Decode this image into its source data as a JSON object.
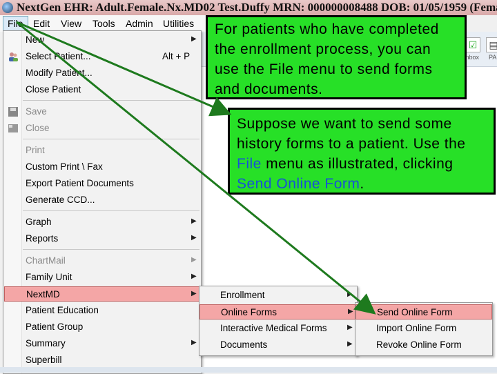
{
  "window": {
    "title": "NextGen EHR: Adult.Female.Nx.MD02 Test.Duffy MRN: 000000008488 DOB: 01/05/1959 (Femal"
  },
  "menubar": {
    "file": "File",
    "edit": "Edit",
    "view": "View",
    "tools": "Tools",
    "admin": "Admin",
    "utilities": "Utilities"
  },
  "toolbar": {
    "inbox": "Inbox",
    "pa": "PA"
  },
  "file_menu": {
    "new": "New",
    "select_patient": "Select Patient...",
    "select_patient_accel": "Alt + P",
    "modify_patient": "Modify Patient...",
    "close_patient": "Close Patient",
    "save": "Save",
    "close": "Close",
    "print": "Print",
    "custom_print_fax": "Custom Print \\ Fax",
    "export_patient_documents": "Export Patient Documents",
    "generate_ccd": "Generate CCD...",
    "graph": "Graph",
    "reports": "Reports",
    "chartmail": "ChartMail",
    "family_unit": "Family Unit",
    "nextmd": "NextMD",
    "patient_education": "Patient Education",
    "patient_group": "Patient Group",
    "summary": "Summary",
    "superbill": "Superbill"
  },
  "nextmd_menu": {
    "enrollment": "Enrollment",
    "online_forms": "Online Forms",
    "interactive_medical_forms": "Interactive Medical Forms",
    "documents": "Documents"
  },
  "online_forms_menu": {
    "send_online_form": "Send Online Form",
    "import_online_form": "Import Online Form",
    "revoke_online_form": "Revoke Online Form"
  },
  "callout1": {
    "text": "For patients who have completed the enrollment process, you can use the File menu to send forms and documents."
  },
  "callout2": {
    "part1": "Suppose we want to send some history forms to a patient.  Use the ",
    "file": "File",
    "part2": " menu as illustrated, clicking ",
    "send": "Send Online Form",
    "part3": "."
  },
  "colors": {
    "highlight": "#f4a6a6",
    "callout_green": "#27e027",
    "arrow_green": "#1e7a1e",
    "link_blue": "#1750d8"
  }
}
